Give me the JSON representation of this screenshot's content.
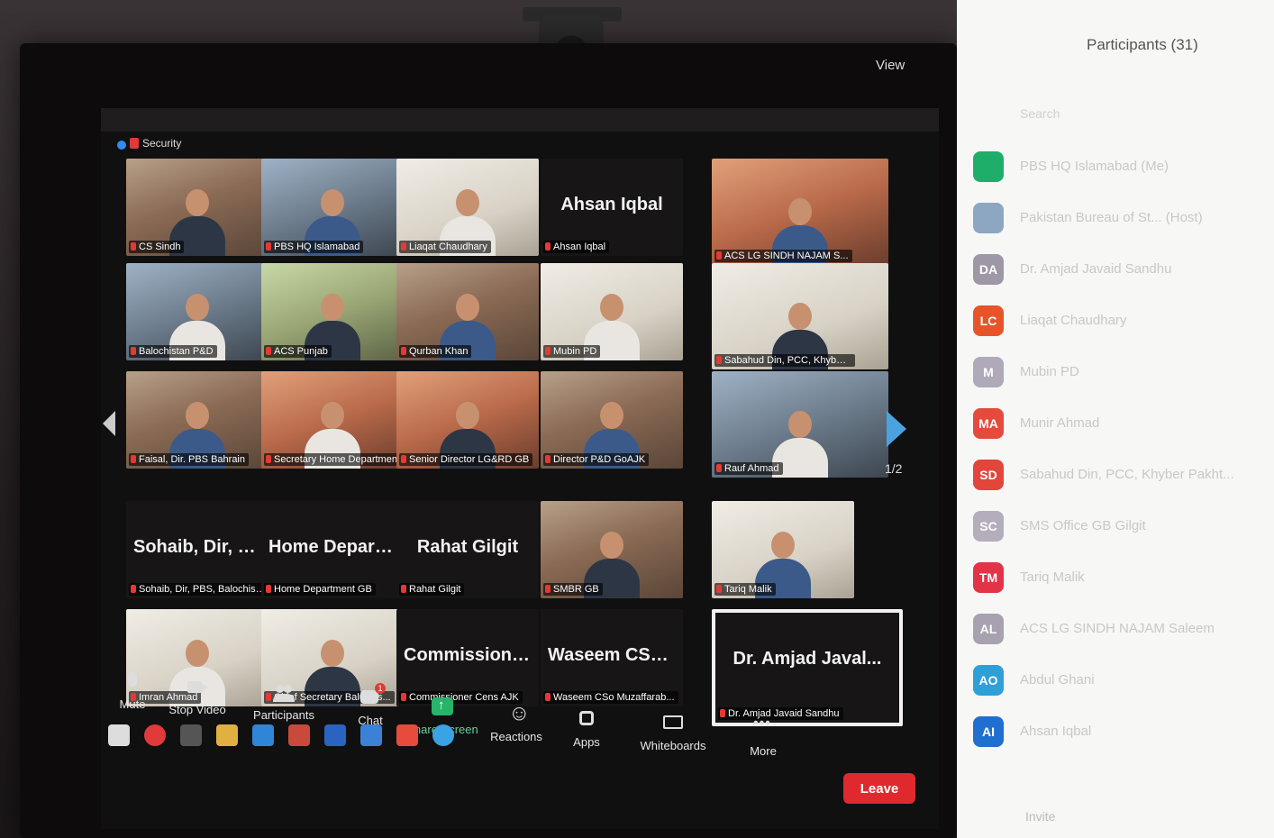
{
  "app": {
    "top_label": "Security",
    "view_label": "View"
  },
  "tiles": [
    {
      "id": "t1",
      "big": "",
      "tag": "CS Sindh"
    },
    {
      "id": "t2",
      "big": "",
      "tag": "PBS HQ Islamabad"
    },
    {
      "id": "t3",
      "big": "",
      "tag": "Liaqat Chaudhary"
    },
    {
      "id": "t4",
      "big": "Ahsan Iqbal",
      "tag": "Ahsan Iqbal"
    },
    {
      "id": "t5",
      "big": "",
      "tag": "ACS LG SINDH NAJAM S..."
    },
    {
      "id": "t6",
      "big": "",
      "tag": "Balochistan P&D"
    },
    {
      "id": "t7",
      "big": "",
      "tag": "ACS Punjab"
    },
    {
      "id": "t8",
      "big": "",
      "tag": "Qurban Khan"
    },
    {
      "id": "t9",
      "big": "",
      "tag": "Mubin PD"
    },
    {
      "id": "t10",
      "big": "",
      "tag": "Sabahud Din, PCC, Khyber Pa..."
    },
    {
      "id": "t11",
      "big": "",
      "tag": "Faisal, Dir. PBS Bahrain"
    },
    {
      "id": "t12",
      "big": "",
      "tag": "Secretary Home Department"
    },
    {
      "id": "t13",
      "big": "",
      "tag": "Senior Director LG&RD GB"
    },
    {
      "id": "t14",
      "big": "",
      "tag": "Director P&D GoAJK"
    },
    {
      "id": "t15",
      "big": "",
      "tag": "Rauf Ahmad"
    },
    {
      "id": "t16",
      "big": "Sohaib, Dir, PBS...",
      "tag": "Sohaib, Dir, PBS, Balochista..."
    },
    {
      "id": "t17",
      "big": "Home Departm...",
      "tag": "Home Department GB"
    },
    {
      "id": "t18",
      "big": "Rahat Gilgit",
      "tag": "Rahat Gilgit"
    },
    {
      "id": "t19",
      "big": "",
      "tag": "SMBR GB"
    },
    {
      "id": "t20",
      "big": "",
      "tag": "Tariq Malik"
    },
    {
      "id": "t21",
      "big": "",
      "tag": "Imran Ahmad"
    },
    {
      "id": "t22",
      "big": "",
      "tag": "Chief Secretary Baluchis..."
    },
    {
      "id": "t23",
      "big": "Commissioner...",
      "tag": "Commissioner Cens AJK"
    },
    {
      "id": "t24",
      "big": "Waseem CSo M...",
      "tag": "Waseem CSo Muzaffarab..."
    },
    {
      "id": "t25",
      "big": "Dr. Amjad Javal...",
      "tag": "Dr. Amjad Javaid Sandhu"
    }
  ],
  "pagination": "1/2",
  "toolbar": {
    "mute": "Mute",
    "stop_video": "Stop Video",
    "participants": "Participants",
    "participants_count": "31",
    "chat": "Chat",
    "chat_badge": "1",
    "share": "Share Screen",
    "reactions": "Reactions",
    "apps": "Apps",
    "whiteboards": "Whiteboards",
    "more": "More",
    "leave": "Leave"
  },
  "panel": {
    "title": "Participants (31)",
    "search_placeholder": "Search",
    "participants": [
      {
        "initials": "",
        "name": "PBS HQ Islamabad (Me)",
        "color": "#1fae6a"
      },
      {
        "initials": "",
        "name": "Pakistan Bureau of St... (Host)",
        "color": "#8da6c2"
      },
      {
        "initials": "DA",
        "name": "Dr. Amjad Javaid Sandhu",
        "color": "#9e97a6"
      },
      {
        "initials": "LC",
        "name": "Liaqat Chaudhary",
        "color": "#e7542a"
      },
      {
        "initials": "M",
        "name": "Mubin PD",
        "color": "#b0a9b9"
      },
      {
        "initials": "MA",
        "name": "Munir Ahmad",
        "color": "#e54a3c"
      },
      {
        "initials": "SD",
        "name": "Sabahud Din, PCC, Khyber Pakht...",
        "color": "#e2463b"
      },
      {
        "initials": "SC",
        "name": "SMS Office GB Gilgit",
        "color": "#b4adbc"
      },
      {
        "initials": "TM",
        "name": "Tariq Malik",
        "color": "#e33347"
      },
      {
        "initials": "AL",
        "name": "ACS LG SINDH NAJAM Saleem",
        "color": "#a7a1b0"
      },
      {
        "initials": "AO",
        "name": "Abdul Ghani",
        "color": "#2f9fd8"
      },
      {
        "initials": "AI",
        "name": "Ahsan Iqbal",
        "color": "#1f6fd1"
      }
    ],
    "footer": "Invite"
  }
}
